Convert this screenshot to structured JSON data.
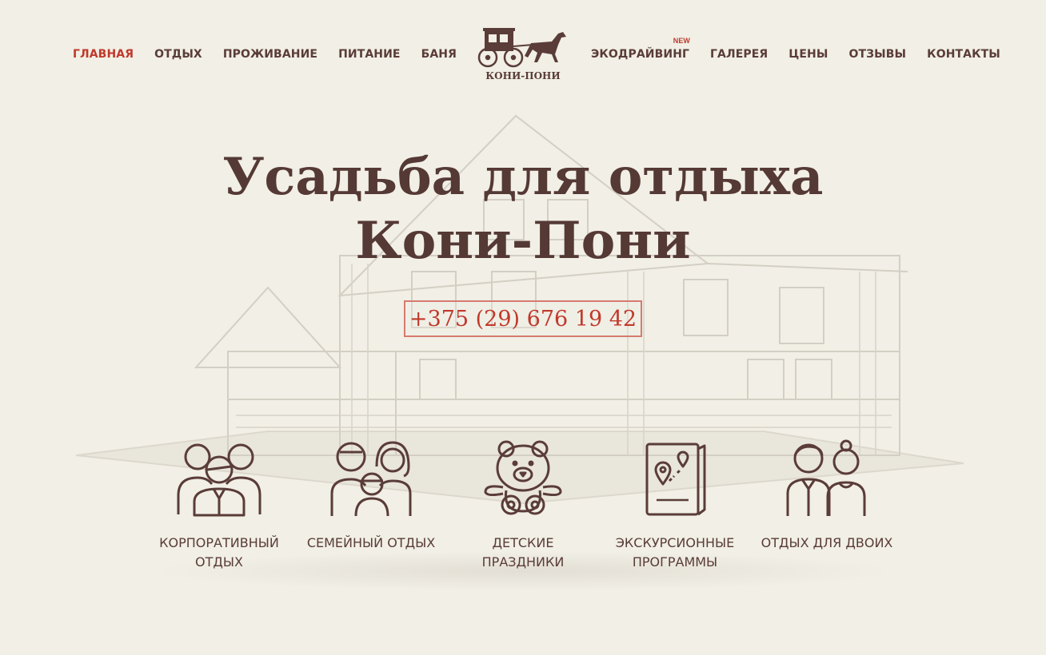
{
  "nav": {
    "left": [
      "ГЛАВНАЯ",
      "ОТДЫХ",
      "ПРОЖИВАНИЕ",
      "ПИТАНИЕ",
      "БАНЯ"
    ],
    "right": [
      "ЭКОДРАЙВИНГ",
      "ГАЛЕРЕЯ",
      "ЦЕНЫ",
      "ОТЗЫВЫ",
      "КОНТАКТЫ"
    ],
    "new_badge": "NEW",
    "active": "ГЛАВНАЯ"
  },
  "logo": {
    "text": "КОНИ-ПОНИ",
    "icon": "carriage-horse-icon"
  },
  "hero": {
    "title_line1": "Усадьба для отдыха",
    "title_line2": "Кони-Пони",
    "phone": "+375 (29) 676 19 42"
  },
  "features": [
    {
      "label": "КОРПОРАТИВНЫЙ\nОТДЫХ",
      "icon": "corporate-group-icon"
    },
    {
      "label": "СЕМЕЙНЫЙ ОТДЫХ",
      "icon": "family-icon"
    },
    {
      "label": "ДЕТСКИЕ\nПРАЗДНИКИ",
      "icon": "teddy-bear-icon"
    },
    {
      "label": "ЭКСКУРСИОННЫЕ\nПРОГРАММЫ",
      "icon": "map-icon"
    },
    {
      "label": "ОТДЫХ ДЛЯ ДВОИХ",
      "icon": "couple-icon"
    }
  ],
  "colors": {
    "background": "#f1efe6",
    "text": "#5a3c38",
    "accent": "#c0392b",
    "phone_border": "#d77a6e"
  }
}
